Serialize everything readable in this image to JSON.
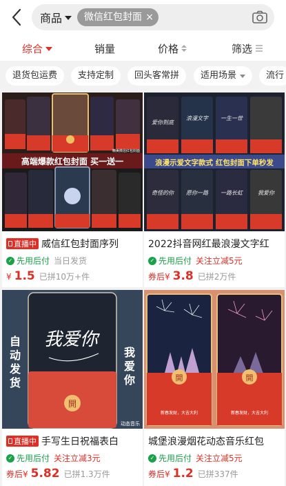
{
  "search": {
    "scope": "商品",
    "query": "微信红包封面",
    "clear": "×"
  },
  "sort": {
    "composite": "综合",
    "sales": "销量",
    "price": "价格",
    "filter": "筛选"
  },
  "tags": [
    {
      "label": "退货包运费"
    },
    {
      "label": "支持定制"
    },
    {
      "label": "回头客常拼"
    },
    {
      "label": "适用场景"
    },
    {
      "label": "流行"
    }
  ],
  "products": [
    {
      "live": "直播中",
      "title": "威信红包封面序列",
      "pay_later": "先用后付",
      "note": "当日发货",
      "price_prefix": "¥",
      "price": "1.5",
      "sold": "已拼10万+件",
      "banner": "高端爆款红包封面  买一送一",
      "tiny": "精美微信红包封面"
    },
    {
      "live": "",
      "title": "2022抖音网红最浪漫文字红",
      "pay_later": "先用后付",
      "note": "关注立减5元",
      "price_prefix": "券后¥",
      "price": "3.8",
      "sold": "已拼2万件",
      "banner": "浪漫示爱文字款式  红包封面下单秒发",
      "cells": [
        "爱你到底",
        "浪漫文字",
        "一生一世",
        "奇怪的你",
        "愿你一路",
        "一路长虹",
        "我爱你"
      ]
    },
    {
      "live": "直播中",
      "title": "手写生日祝福表白",
      "pay_later": "先用后付",
      "note": "关注立减3元",
      "price_prefix": "券后¥",
      "price": "5.82",
      "sold": "已拼1.3万件",
      "left_text": "自动发货",
      "right_text": "我爱你",
      "script": "我爱你",
      "tiny": "动态音乐",
      "open": "開"
    },
    {
      "live": "",
      "title": "城堡浪漫烟花动态音乐红包",
      "pay_later": "先用后付",
      "note": "关注立减5元",
      "price_prefix": "券后¥",
      "price": "1.2",
      "sold": "已拼337件",
      "open": "開",
      "caption": "新春发财，大吉大利"
    }
  ]
}
